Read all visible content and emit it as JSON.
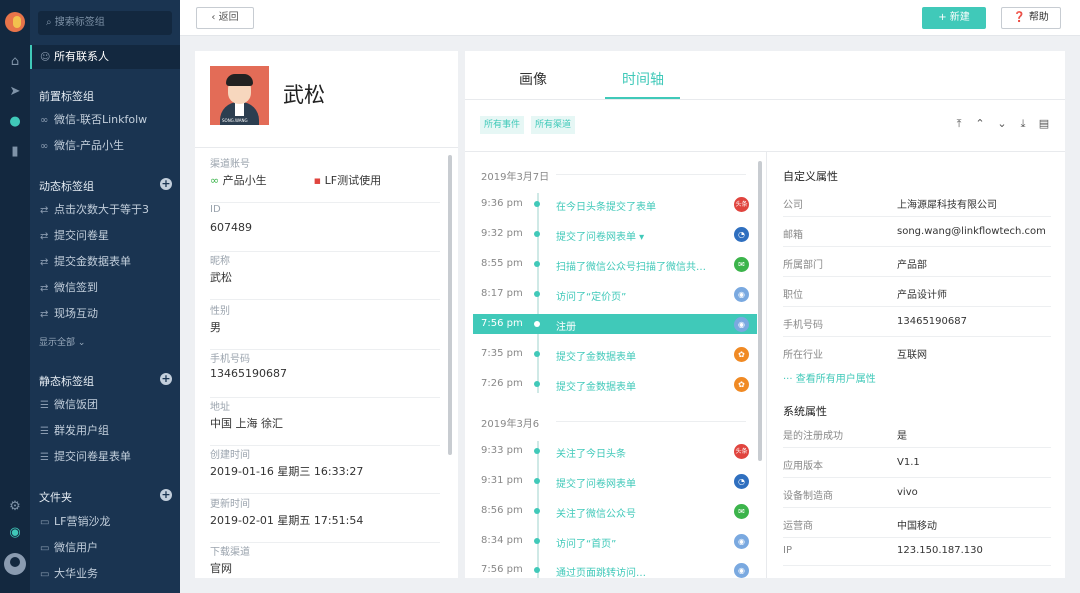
{
  "sidebar": {
    "search_placeholder": "搜索标签组",
    "all_contacts": "所有联系人",
    "front_title": "前置标签组",
    "front_items": [
      "微信-联否Linkfolw",
      "微信-产品小生"
    ],
    "dynamic_title": "动态标签组",
    "dynamic_items": [
      "点击次数大于等于3",
      "提交问卷星",
      "提交金数据表单",
      "微信签到",
      "现场互动"
    ],
    "show_all": "显示全部",
    "static_title": "静态标签组",
    "static_items": [
      "微信饭团",
      "群发用户组",
      "提交问卷星表单"
    ],
    "folder_title": "文件夹",
    "folder_items": [
      "LF营销沙龙",
      "微信用户",
      "大华业务"
    ]
  },
  "topbar": {
    "back": "返回",
    "new": "新建",
    "help": "帮助"
  },
  "profile": {
    "photo_caption": "SONG.WANG",
    "name": "武松",
    "channel_label": "渠道账号",
    "channels": [
      "产品小生",
      "LF测试使用"
    ],
    "fields": [
      {
        "label": "ID",
        "value": "607489"
      },
      {
        "label": "昵称",
        "value": "武松"
      },
      {
        "label": "性别",
        "value": "男"
      },
      {
        "label": "手机号码",
        "value": "13465190687"
      },
      {
        "label": "地址",
        "value": "中国 上海 徐汇"
      },
      {
        "label": "创建时间",
        "value": "2019-01-16 星期三 16:33:27"
      },
      {
        "label": "更新时间",
        "value": "2019-02-01 星期五 17:51:54"
      },
      {
        "label": "下载渠道",
        "value": "官网"
      }
    ]
  },
  "tabs": {
    "portrait": "画像",
    "timeline": "时间轴"
  },
  "filters": {
    "events": "所有事件",
    "channels": "所有渠道"
  },
  "timeline": {
    "day1": "2019年3月7日",
    "day1_rows": [
      {
        "time": "9:36 pm",
        "desc": "在今日头条提交了表单",
        "color": "#e0443e",
        "icon": "头条"
      },
      {
        "time": "9:32 pm",
        "desc": "提交了问卷网表单 ▾",
        "color": "#2f6fbf",
        "icon": "◔"
      },
      {
        "time": "8:55 pm",
        "desc": "扫描了微信公众号扫描了微信共…",
        "color": "#3cb44b",
        "icon": "✉"
      },
      {
        "time": "8:17 pm",
        "desc": "访问了“定价页”",
        "color": "#7aa9e0",
        "icon": "◉"
      },
      {
        "time": "7:56 pm",
        "desc": "注册",
        "color": "#7aa9e0",
        "icon": "◉"
      },
      {
        "time": "7:35 pm",
        "desc": "提交了金数据表单",
        "color": "#f08a24",
        "icon": "✿"
      },
      {
        "time": "7:26 pm",
        "desc": "提交了金数据表单",
        "color": "#f08a24",
        "icon": "✿"
      }
    ],
    "day2": "2019年3月6",
    "day2_rows": [
      {
        "time": "9:33 pm",
        "desc": "关注了今日头条",
        "color": "#e0443e",
        "icon": "头条"
      },
      {
        "time": "9:31 pm",
        "desc": "提交了问卷网表单",
        "color": "#2f6fbf",
        "icon": "◔"
      },
      {
        "time": "8:56 pm",
        "desc": "关注了微信公众号",
        "color": "#3cb44b",
        "icon": "✉"
      },
      {
        "time": "8:34 pm",
        "desc": "访问了“首页”",
        "color": "#7aa9e0",
        "icon": "◉"
      },
      {
        "time": "7:56 pm",
        "desc": "通过页面跳转访问…",
        "color": "#7aa9e0",
        "icon": "◉"
      }
    ]
  },
  "custom_props": {
    "title": "自定义属性",
    "rows": [
      {
        "k": "公司",
        "v": "上海源犀科技有限公司"
      },
      {
        "k": "邮箱",
        "v": "song.wang@linkflowtech.com"
      },
      {
        "k": "所属部门",
        "v": "产品部"
      },
      {
        "k": "职位",
        "v": "产品设计师"
      },
      {
        "k": "手机号码",
        "v": "13465190687"
      },
      {
        "k": "所在行业",
        "v": "互联网"
      }
    ],
    "see_all": "查看所有用户属性"
  },
  "system_props": {
    "title": "系统属性",
    "rows": [
      {
        "k": "是的注册成功",
        "v": "是"
      },
      {
        "k": "应用版本",
        "v": "V1.1"
      },
      {
        "k": "设备制造商",
        "v": "vivo"
      },
      {
        "k": "运营商",
        "v": "中国移动"
      },
      {
        "k": "IP",
        "v": "123.150.187.130"
      }
    ]
  },
  "colors": {
    "accent": "#40c9b9",
    "sidebar": "#1a3451",
    "rail": "#13283f"
  }
}
